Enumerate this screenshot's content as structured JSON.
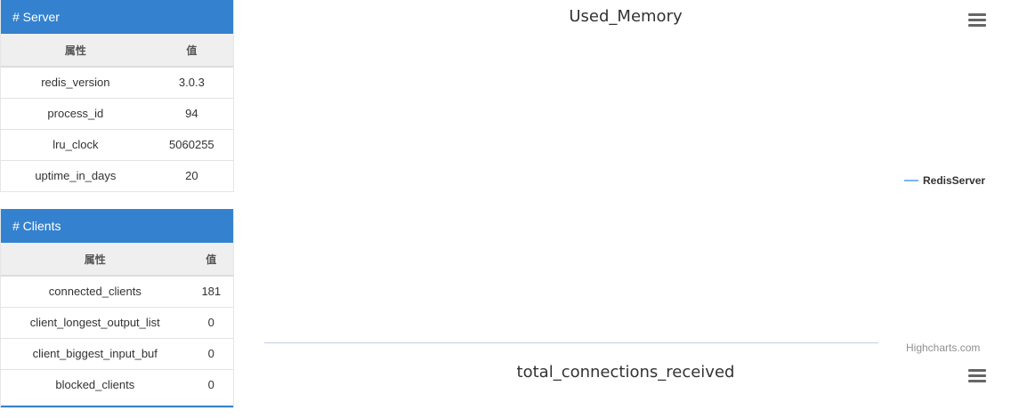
{
  "server": {
    "title": "# Server",
    "headers": [
      "属性",
      "值"
    ],
    "rows": [
      {
        "key": "redis_version",
        "value": "3.0.3"
      },
      {
        "key": "process_id",
        "value": "94"
      },
      {
        "key": "lru_clock",
        "value": "5060255"
      },
      {
        "key": "uptime_in_days",
        "value": "20"
      }
    ]
  },
  "clients": {
    "title": "# Clients",
    "headers": [
      "属性",
      "值"
    ],
    "rows": [
      {
        "key": "connected_clients",
        "value": "181"
      },
      {
        "key": "client_longest_output_list",
        "value": "0"
      },
      {
        "key": "client_biggest_input_buf",
        "value": "0"
      },
      {
        "key": "blocked_clients",
        "value": "0"
      }
    ]
  },
  "charts": {
    "used_memory": {
      "title": "Used_Memory",
      "legend": "RedisServer",
      "credits": "Highcharts.com",
      "menu_icon": "hamburger-menu-icon"
    },
    "total_connections": {
      "title": "total_connections_received",
      "menu_icon": "hamburger-menu-icon"
    }
  },
  "colors": {
    "panel_header": "#3482cf",
    "series_line": "#7cb5ec"
  }
}
